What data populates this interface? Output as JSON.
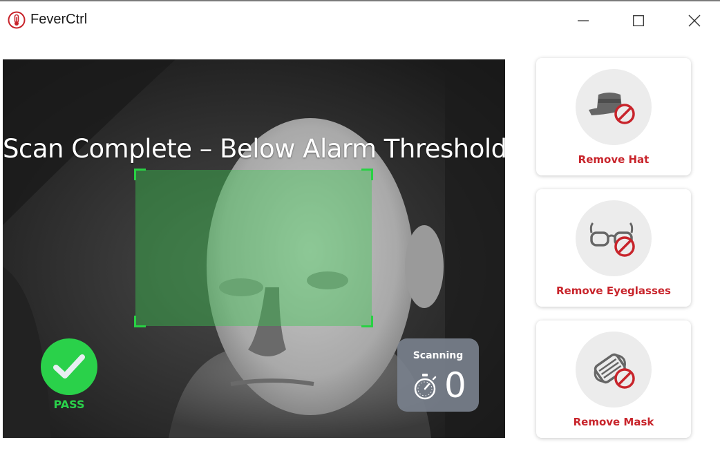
{
  "window": {
    "title": "FeverCtrl",
    "app_icon": "thermometer-icon",
    "controls": {
      "minimize_icon": "minimize-icon",
      "maximize_icon": "maximize-icon",
      "close_icon": "close-icon"
    }
  },
  "camera": {
    "status_message": "Scan Complete – Below Alarm Threshold",
    "result": {
      "label": "PASS",
      "icon": "checkmark-icon",
      "color": "#2ad14a"
    },
    "scanning": {
      "label": "Scanning",
      "icon": "stopwatch-icon",
      "count": "0"
    },
    "face_box_color": "#28d143"
  },
  "instructions": [
    {
      "label": "Remove Hat",
      "icon": "no-hat-icon"
    },
    {
      "label": "Remove Eyeglasses",
      "icon": "no-eyeglasses-icon"
    },
    {
      "label": "Remove Mask",
      "icon": "no-mask-icon"
    }
  ],
  "colors": {
    "accent_red": "#c8242b",
    "pass_green": "#2ad14a"
  }
}
